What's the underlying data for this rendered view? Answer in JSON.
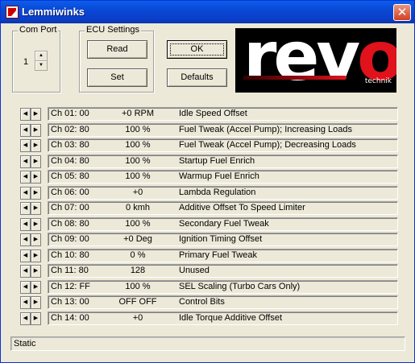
{
  "window": {
    "title": "Lemmiwinks"
  },
  "com_port": {
    "label": "Com Port",
    "value": "1"
  },
  "ecu_settings": {
    "label": "ECU Settings",
    "read_label": "Read",
    "set_label": "Set"
  },
  "buttons": {
    "ok_label": "OK",
    "defaults_label": "Defaults"
  },
  "logo": {
    "main": "revo",
    "sub": "technik"
  },
  "channels": [
    {
      "ch": "Ch 01: 00",
      "value": "+0 RPM",
      "desc": "Idle Speed Offset"
    },
    {
      "ch": "Ch 02: 80",
      "value": "100 %",
      "desc": "Fuel Tweak (Accel Pump); Increasing Loads"
    },
    {
      "ch": "Ch 03: 80",
      "value": "100 %",
      "desc": "Fuel Tweak (Accel Pump); Decreasing Loads"
    },
    {
      "ch": "Ch 04: 80",
      "value": "100 %",
      "desc": "Startup Fuel Enrich"
    },
    {
      "ch": "Ch 05: 80",
      "value": "100 %",
      "desc": "Warmup Fuel Enrich"
    },
    {
      "ch": "Ch 06: 00",
      "value": "+0",
      "desc": "Lambda Regulation"
    },
    {
      "ch": "Ch 07: 00",
      "value": "0 kmh",
      "desc": "Additive Offset To Speed Limiter"
    },
    {
      "ch": "Ch 08: 80",
      "value": "100 %",
      "desc": "Secondary Fuel Tweak"
    },
    {
      "ch": "Ch 09: 00",
      "value": "+0 Deg",
      "desc": "Ignition Timing Offset"
    },
    {
      "ch": "Ch 10: 80",
      "value": "0 %",
      "desc": "Primary Fuel Tweak"
    },
    {
      "ch": "Ch 11: 80",
      "value": "128",
      "desc": "Unused"
    },
    {
      "ch": "Ch 12: FF",
      "value": "100 %",
      "desc": "SEL Scaling (Turbo Cars Only)"
    },
    {
      "ch": "Ch 13: 00",
      "value": "OFF  OFF",
      "desc": "Control Bits"
    },
    {
      "ch": "Ch 14: 00",
      "value": "+0",
      "desc": "Idle Torque Additive Offset"
    }
  ],
  "status": {
    "text": "Static"
  },
  "colors": {
    "title_bar": "#0a48d6",
    "close_button": "#d1401f",
    "logo_accent": "#e0121b",
    "dialog_bg": "#ece9d8"
  },
  "icons": {
    "app": "app-icon",
    "close": "close-icon",
    "spin_up": "arrow-up-icon",
    "spin_down": "arrow-down-icon",
    "left": "arrow-left-icon",
    "right": "arrow-right-icon"
  }
}
